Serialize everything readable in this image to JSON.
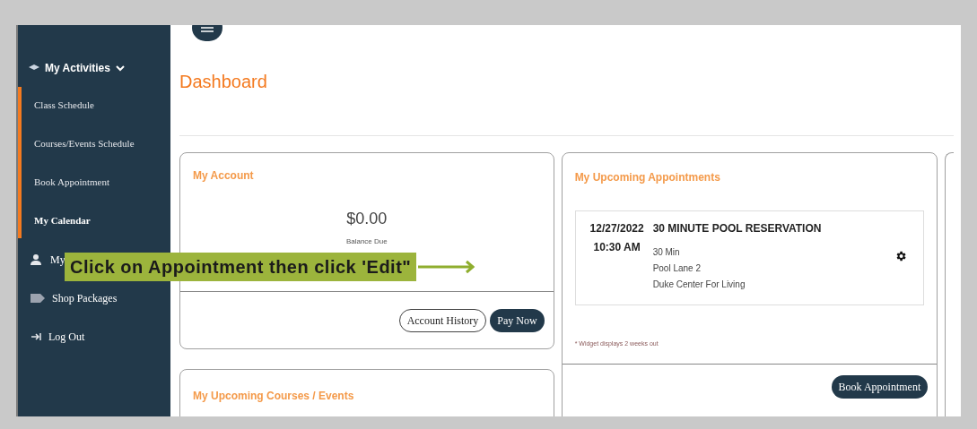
{
  "sidebar": {
    "group": {
      "label": "My Activities",
      "expanded": true,
      "items": [
        {
          "label": "Class Schedule",
          "selected": false
        },
        {
          "label": "Courses/Events Schedule",
          "selected": false
        },
        {
          "label": "Book Appointment",
          "selected": false
        },
        {
          "label": "My Calendar",
          "selected": true
        }
      ]
    },
    "items": [
      {
        "kind": "person",
        "label": "My"
      },
      {
        "kind": "tag",
        "label": "Shop Packages"
      },
      {
        "kind": "logout",
        "label": "Log Out"
      }
    ]
  },
  "page_title": "Dashboard",
  "account": {
    "title": "My Account",
    "amount": "$0.00",
    "amount_label": "Balance Due",
    "buttons": [
      {
        "label": "Account History",
        "kind": "outline"
      },
      {
        "label": "Pay Now",
        "kind": "solid"
      }
    ]
  },
  "courses": {
    "title": "My Upcoming Courses / Events"
  },
  "appointments": {
    "title": "My Upcoming Appointments",
    "items": [
      {
        "date": "12/27/2022",
        "time": "10:30 AM",
        "name": "30 MINUTE POOL RESERVATION",
        "details": [
          "30 Min",
          "Pool Lane 2",
          "Duke Center For Living"
        ]
      }
    ],
    "note": "* Widget displays 2 weeks out",
    "button": "Book Appointment"
  },
  "callout": {
    "text": "Click on Appointment then click 'Edit\""
  }
}
